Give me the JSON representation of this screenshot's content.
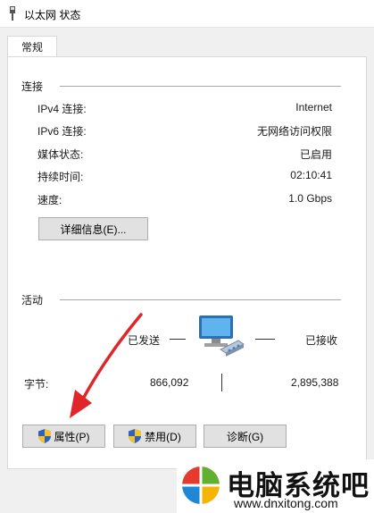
{
  "window": {
    "title": "以太网 状态"
  },
  "tabs": [
    {
      "label": "常规"
    }
  ],
  "connection": {
    "section_title": "连接",
    "rows": [
      {
        "label": "IPv4 连接:",
        "value": "Internet"
      },
      {
        "label": "IPv6 连接:",
        "value": "无网络访问权限"
      },
      {
        "label": "媒体状态:",
        "value": "已启用"
      },
      {
        "label": "持续时间:",
        "value": "02:10:41"
      },
      {
        "label": "速度:",
        "value": "1.0 Gbps"
      }
    ],
    "details_button": "详细信息(E)..."
  },
  "activity": {
    "section_title": "活动",
    "sent_label": "已发送",
    "received_label": "已接收",
    "bytes_label": "字节:",
    "bytes_sent": "866,092",
    "bytes_received": "2,895,388"
  },
  "buttons": {
    "properties": "属性(P)",
    "disable": "禁用(D)",
    "diagnose": "诊断(G)"
  },
  "watermark": {
    "title": "电脑系统吧",
    "url": "www.dnxitong.com"
  },
  "colors": {
    "arrow": "#e0262b",
    "logo_red": "#e63a2e",
    "logo_green": "#62b02f",
    "logo_blue": "#1e88d6",
    "logo_yellow": "#f4b400"
  }
}
